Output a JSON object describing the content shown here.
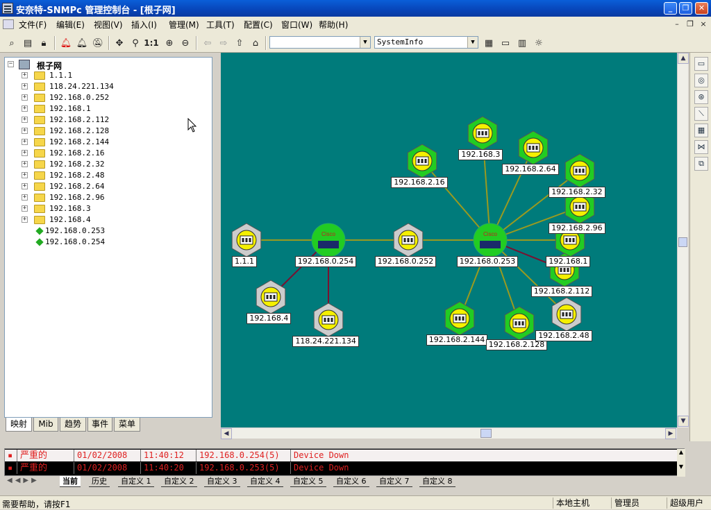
{
  "window": {
    "title": "安奈特-SNMPc 管理控制台 - [根子网]",
    "minimize": "_",
    "restore": "❐",
    "close": "✕"
  },
  "menu": [
    "文件(F)",
    "编辑(E)",
    "视图(V)",
    "插入(I)",
    "管理(M)",
    "工具(T)",
    "配置(C)",
    "窗口(W)",
    "帮助(H)"
  ],
  "mdi_controls": [
    "–",
    "❐",
    "×"
  ],
  "toolbar": {
    "scale_label": "1:1",
    "combo1_value": "",
    "combo2_value": "SystemInfo"
  },
  "tree": {
    "root": "根子网",
    "subnets": [
      "1.1.1",
      "118.24.221.134",
      "192.168.0.252",
      "192.168.1",
      "192.168.2.112",
      "192.168.2.128",
      "192.168.2.144",
      "192.168.2.16",
      "192.168.2.32",
      "192.168.2.48",
      "192.168.2.64",
      "192.168.2.96",
      "192.168.3",
      "192.168.4"
    ],
    "devices": [
      "192.168.0.253",
      "192.168.0.254"
    ]
  },
  "left_tabs": [
    "映射",
    "Mib",
    "趋势",
    "事件",
    "菜单"
  ],
  "map": {
    "background": "#007b7b",
    "nodes": [
      {
        "id": "n111",
        "label": "1.1.1",
        "kind": "subnet",
        "color": "#cccccc"
      },
      {
        "id": "n254",
        "label": "192.168.0.254",
        "kind": "router",
        "color": "#22cc22"
      },
      {
        "id": "n252",
        "label": "192.168.0.252",
        "kind": "subnet",
        "color": "#cccccc"
      },
      {
        "id": "n253",
        "label": "192.168.0.253",
        "kind": "router",
        "color": "#22cc22"
      },
      {
        "id": "n4",
        "label": "192.168.4",
        "kind": "subnet",
        "color": "#cccccc"
      },
      {
        "id": "n118",
        "label": "118.24.221.134",
        "kind": "subnet",
        "color": "#cccccc"
      },
      {
        "id": "n3",
        "label": "192.168.3",
        "kind": "subnet",
        "color": "#22cc22"
      },
      {
        "id": "n216",
        "label": "192.168.2.16",
        "kind": "subnet",
        "color": "#22cc22"
      },
      {
        "id": "n264",
        "label": "192.168.2.64",
        "kind": "subnet",
        "color": "#22cc22"
      },
      {
        "id": "n232",
        "label": "192.168.2.32",
        "kind": "subnet",
        "color": "#22cc22"
      },
      {
        "id": "n296",
        "label": "192.168.2.96",
        "kind": "subnet",
        "color": "#22cc22"
      },
      {
        "id": "n21",
        "label": "192.168.1",
        "kind": "subnet",
        "color": "#22cc22"
      },
      {
        "id": "n2112",
        "label": "192.168.2.112",
        "kind": "subnet",
        "color": "#22cc22"
      },
      {
        "id": "n2144",
        "label": "192.168.2.144",
        "kind": "subnet",
        "color": "#22cc22"
      },
      {
        "id": "n2128",
        "label": "192.168.2.128",
        "kind": "subnet",
        "color": "#22cc22"
      },
      {
        "id": "n248",
        "label": "192.168.2.48",
        "kind": "subnet",
        "color": "#cccccc"
      }
    ],
    "router_badge": "Cisco"
  },
  "alarms": [
    {
      "severity": "严重的",
      "date": "01/02/2008",
      "time": "11:40:12",
      "source": "192.168.0.254(5)",
      "message": "Device Down"
    },
    {
      "severity": "严重的",
      "date": "01/02/2008",
      "time": "11:40:20",
      "source": "192.168.0.253(5)",
      "message": "Device Down"
    }
  ],
  "bottom_tabs": [
    "当前",
    "历史",
    "自定义 1",
    "自定义 2",
    "自定义 3",
    "自定义 4",
    "自定义 5",
    "自定义 6",
    "自定义 7",
    "自定义 8"
  ],
  "status": {
    "help": "需要帮助，请按F1",
    "host": "本地主机",
    "role": "管理员",
    "user": "超级用户"
  }
}
